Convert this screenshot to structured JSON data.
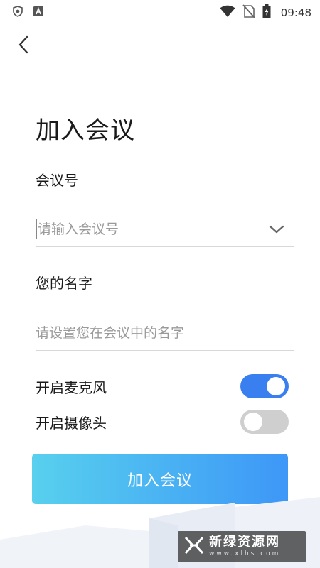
{
  "status_bar": {
    "time": "09:48",
    "icons": [
      "shield-icon",
      "app-a-icon",
      "wifi-icon",
      "no-sim-icon",
      "battery-charging-icon"
    ]
  },
  "header": {
    "back_icon": "chevron-left-icon",
    "title": "加入会议"
  },
  "form": {
    "meeting_id": {
      "label": "会议号",
      "value": "",
      "placeholder": "请输入会议号",
      "dropdown_icon": "chevron-down-icon"
    },
    "name": {
      "label": "您的名字",
      "value": "",
      "placeholder": "请设置您在会议中的名字"
    },
    "microphone": {
      "label": "开启麦克风",
      "enabled": true
    },
    "camera": {
      "label": "开启摄像头",
      "enabled": false
    }
  },
  "actions": {
    "join_label": "加入会议"
  },
  "watermark": {
    "main": "新绿资源网",
    "sub": "www.xlhs.com"
  },
  "colors": {
    "accent": "#3a7ff0",
    "button_gradient_start": "#58d0ee",
    "button_gradient_end": "#3d97f7",
    "toggle_off": "#cfcfcf"
  }
}
